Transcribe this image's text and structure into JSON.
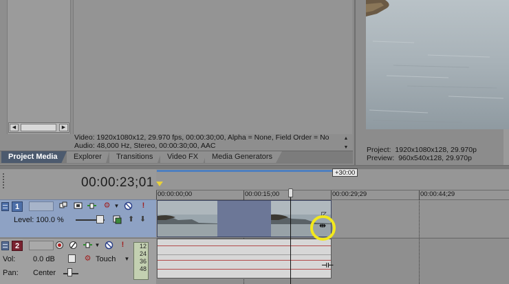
{
  "media_panel": {
    "info_line_1": "Video: 1920x1080x12, 29.970 fps, 00:00:30;00, Alpha = None, Field Order = No",
    "info_line_2": "Audio: 48,000 Hz, Stereo, 00:00:30;00, AAC"
  },
  "tabs": [
    {
      "label": "Project Media",
      "active": true
    },
    {
      "label": "Explorer"
    },
    {
      "label": "Transitions"
    },
    {
      "label": "Video FX"
    },
    {
      "label": "Media Generators"
    }
  ],
  "preview": {
    "project_line": "Project:  1920x1080x128, 29.970p",
    "preview_line": "Preview:  960x540x128, 29.970p"
  },
  "timeline": {
    "timecode": "00:00:23;01",
    "loop_end_label": "+30:00",
    "ruler_labels": [
      "00:00:00;00",
      "00:00:15;00",
      "00:00:29;29",
      "00:00:44;29"
    ]
  },
  "track1": {
    "number": "1",
    "level_label": "Level: 100.0 %",
    "level_value": 1.0
  },
  "track2": {
    "number": "2",
    "vol_label": "Vol:",
    "vol_value": "0.0 dB",
    "automation_mode": "Touch",
    "pan_label": "Pan:",
    "pan_value": "Center",
    "meter_labels": [
      "12",
      "24",
      "36",
      "48"
    ]
  },
  "colors": {
    "video_track": "#8ea2c4",
    "audio_track_number": "#7a2331",
    "highlight": "#f2e81c",
    "loop_region": "#4e7fbf"
  },
  "icons": {
    "track1": [
      "track-motion-icon",
      "event-pan-crop-icon",
      "track-fx-icon",
      "compositing-icon",
      "mute-icon",
      "solo-icon"
    ],
    "track2": [
      "arm-record-icon",
      "invert-phase-icon",
      "track-fx-icon",
      "mute-icon",
      "solo-icon"
    ]
  }
}
